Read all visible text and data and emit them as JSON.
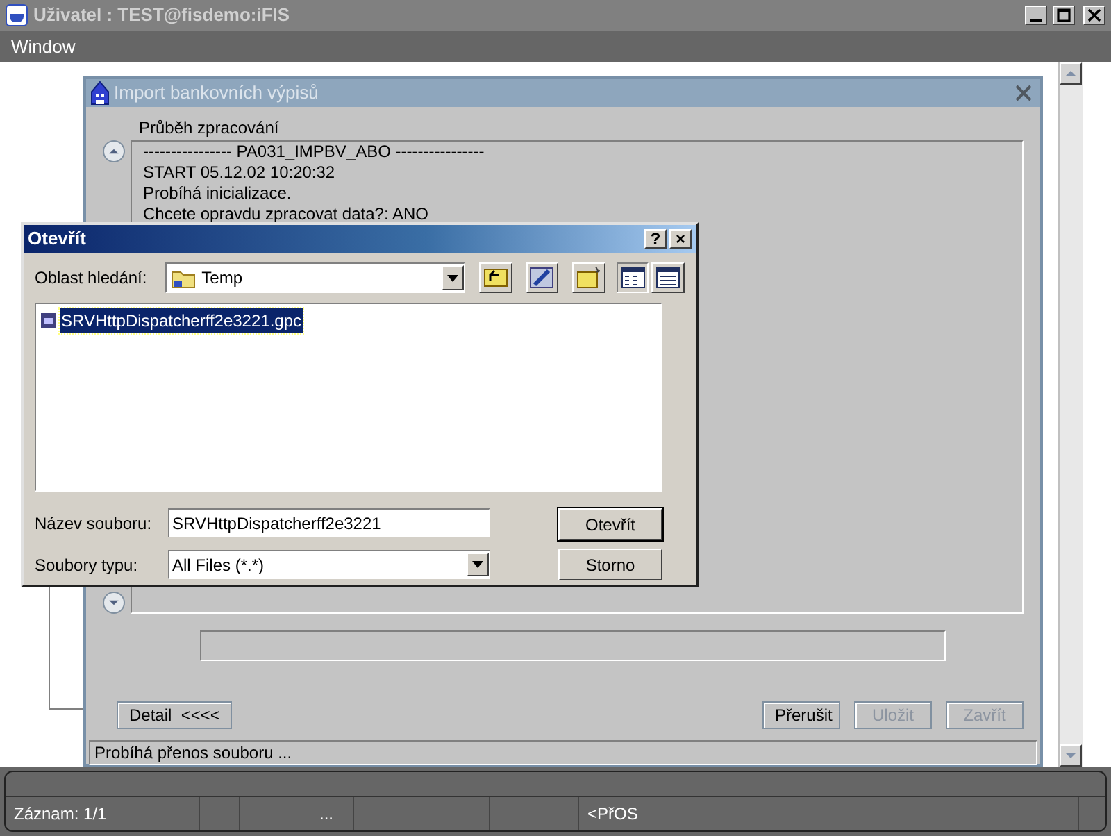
{
  "window": {
    "title": "Uživatel : TEST@fisdemo:iFIS"
  },
  "menu": [
    {
      "label": "Window"
    }
  ],
  "import_window": {
    "title": "Import bankovních výpisů",
    "section_label": "Průběh zpracování",
    "log": [
      "---------------- PA031_IMPBV_ABO ----------------",
      "START 05.12.02 10:20:32",
      "Probíhá inicializace.",
      "Chcete opravdu zpracovat data?: ANO"
    ],
    "progress": {
      "level": 0
    },
    "buttons": [
      {
        "label": "Detail  <<<<",
        "disabled": false
      },
      {
        "label": "Přerušit",
        "disabled": false
      },
      {
        "label": "Uložit",
        "disabled": true
      },
      {
        "label": "Zavřít",
        "disabled": true
      }
    ],
    "status": "Probíhá přenos souboru ..."
  },
  "open_dialog": {
    "title": "Otevřít",
    "help": "?",
    "close": "×",
    "look_in_label": "Oblast hledání:",
    "look_in": "Temp",
    "files": [
      {
        "name": "SRVHttpDispatcherff2e3221.gpc",
        "selected": true
      }
    ],
    "filename_label": "Název souboru:",
    "filename": "SRVHttpDispatcherff2e3221",
    "filetype_label": "Soubory typu:",
    "filetype": "All Files (*.*)",
    "buttons": [
      {
        "label": "Otevřít",
        "default": true
      },
      {
        "label": "Storno",
        "default": false
      }
    ]
  },
  "status_bar": {
    "fields": [
      "Záznam: 1/1",
      "...",
      "<PřOS"
    ]
  }
}
